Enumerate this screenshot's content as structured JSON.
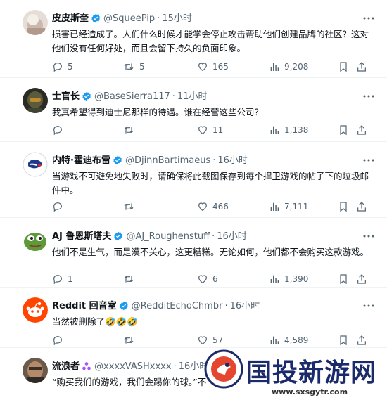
{
  "tweets": [
    {
      "name": "皮皮斯奎",
      "handle": "@SqueePip",
      "time": "15小时",
      "text": "损害已经造成了。人们什么时候才能学会停止攻击帮助他们创建品牌的社区？这对他们没有任何好处，而且会留下持久的负面印象。",
      "replies": "5",
      "retweets": "5",
      "likes": "165",
      "views": "9,208",
      "verified": true
    },
    {
      "name": "士官长",
      "handle": "@BaseSierra117",
      "time": "11小时",
      "text": "我真希望得到迪士尼那样的待遇。谁在经营这些公司？",
      "replies": "",
      "retweets": "",
      "likes": "11",
      "views": "1,138",
      "verified": true
    },
    {
      "name": "内特·霍迪布雷",
      "handle": "@DjinnBartimaeus",
      "time": "16小时",
      "text": "当游戏不可避免地失败时，请确保将此截图保存到每个捍卫游戏的帖子下的垃圾邮件中。",
      "replies": "",
      "retweets": "",
      "likes": "466",
      "views": "7,111",
      "verified": true
    },
    {
      "name": "AJ 鲁恩斯塔夫",
      "handle": "@AJ_Roughenstuff",
      "time": "16小时",
      "text": "他们不是生气，而是漠不关心，这更糟糕。无论如何，他们都不会购买这款游戏。",
      "replies": "1",
      "retweets": "",
      "likes": "6",
      "views": "1,390",
      "verified": true
    },
    {
      "name": "Reddit 回音室",
      "handle": "@RedditEchoChmbr",
      "time": "16小时",
      "text": "当然被删除了🤣🤣🤣",
      "replies": "",
      "retweets": "",
      "likes": "57",
      "views": "4,589",
      "verified": true
    },
    {
      "name": "流浪者",
      "handle": "@xxxxVASHxxxx",
      "time": "16小时",
      "text": "“购买我们的游戏，我们会踢你的球。”不",
      "replies": "",
      "retweets": "",
      "likes": "",
      "views": "",
      "verified": false
    }
  ],
  "watermark": {
    "title": "国投新游网",
    "url": "www.sxsgytr.com"
  },
  "colors": {
    "verified": "#1d9bf0",
    "secondary_text": "#536471",
    "divider": "#eff3f4",
    "watermark": "#1b2a6b"
  }
}
